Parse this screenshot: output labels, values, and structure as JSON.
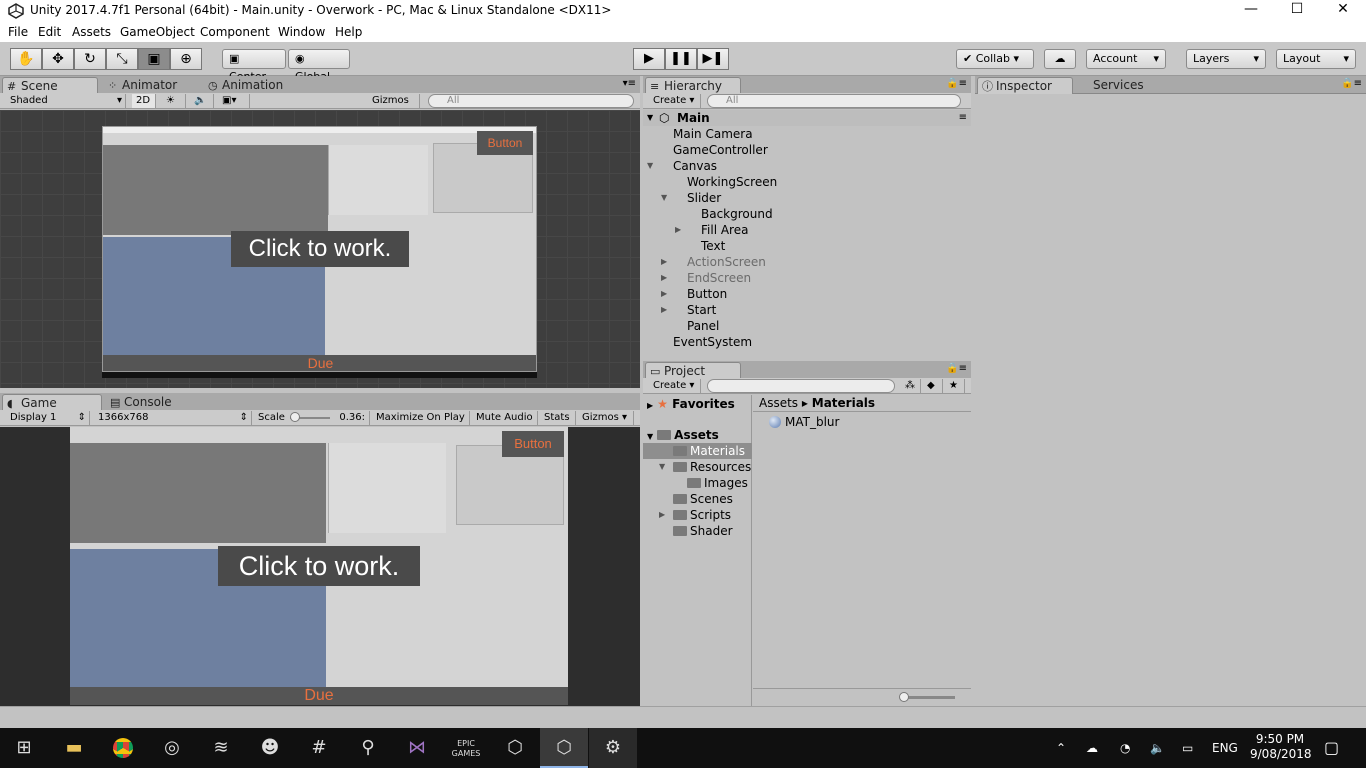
{
  "window": {
    "title": "Unity 2017.4.7f1 Personal (64bit) - Main.unity - Overwork - PC, Mac & Linux Standalone <DX11>",
    "minimize": "—",
    "maximize": "☐",
    "close": "✕"
  },
  "menu": [
    "File",
    "Edit",
    "Assets",
    "GameObject",
    "Component",
    "Window",
    "Help"
  ],
  "toolbar": {
    "tools": [
      "hand-tool",
      "move-tool",
      "rotate-tool",
      "scale-tool",
      "rect-tool",
      "transform-tool"
    ],
    "pivot": "Center",
    "space": "Global",
    "collab": "Collab",
    "account": "Account",
    "layers": "Layers",
    "layout": "Layout"
  },
  "scene": {
    "tabs": [
      "Scene",
      "Animator",
      "Animation"
    ],
    "shading": "Shaded",
    "mode_2d": "2D",
    "gizmos": "Gizmos",
    "search_placeholder": "All",
    "button_text": "Button",
    "click_text": "Click to work.",
    "due_text": "Due"
  },
  "game": {
    "tabs": [
      "Game",
      "Console"
    ],
    "display": "Display 1",
    "resolution": "1366x768",
    "scale_label": "Scale",
    "scale_value": "0.36:",
    "maximize_on_play": "Maximize On Play",
    "mute_audio": "Mute Audio",
    "stats": "Stats",
    "gizmos": "Gizmos",
    "button_text": "Button",
    "click_text": "Click to work.",
    "due_text": "Due"
  },
  "hierarchy": {
    "tab": "Hierarchy",
    "create": "Create",
    "search_placeholder": "All",
    "scene_name": "Main",
    "items": [
      {
        "label": "Main Camera",
        "depth": 1,
        "arrow": "",
        "dim": false
      },
      {
        "label": "GameController",
        "depth": 1,
        "arrow": "",
        "dim": false
      },
      {
        "label": "Canvas",
        "depth": 1,
        "arrow": "▼",
        "dim": false
      },
      {
        "label": "WorkingScreen",
        "depth": 2,
        "arrow": "",
        "dim": false
      },
      {
        "label": "Slider",
        "depth": 2,
        "arrow": "▼",
        "dim": false
      },
      {
        "label": "Background",
        "depth": 3,
        "arrow": "",
        "dim": false
      },
      {
        "label": "Fill Area",
        "depth": 3,
        "arrow": "▶",
        "dim": false
      },
      {
        "label": "Text",
        "depth": 3,
        "arrow": "",
        "dim": false
      },
      {
        "label": "ActionScreen",
        "depth": 2,
        "arrow": "▶",
        "dim": true
      },
      {
        "label": "EndScreen",
        "depth": 2,
        "arrow": "▶",
        "dim": true
      },
      {
        "label": "Button",
        "depth": 2,
        "arrow": "▶",
        "dim": false
      },
      {
        "label": "Start",
        "depth": 2,
        "arrow": "▶",
        "dim": false
      },
      {
        "label": "Panel",
        "depth": 2,
        "arrow": "",
        "dim": false
      },
      {
        "label": "EventSystem",
        "depth": 1,
        "arrow": "",
        "dim": false
      }
    ]
  },
  "project": {
    "tab": "Project",
    "create": "Create",
    "favorites": "Favorites",
    "assets": "Assets",
    "folders": [
      {
        "label": "Materials",
        "depth": 1,
        "arrow": "",
        "selected": true
      },
      {
        "label": "Resources",
        "depth": 1,
        "arrow": "▼",
        "selected": false
      },
      {
        "label": "Images",
        "depth": 2,
        "arrow": "",
        "selected": false
      },
      {
        "label": "Scenes",
        "depth": 1,
        "arrow": "",
        "selected": false
      },
      {
        "label": "Scripts",
        "depth": 1,
        "arrow": "▶",
        "selected": false
      },
      {
        "label": "Shader",
        "depth": 1,
        "arrow": "",
        "selected": false
      }
    ],
    "breadcrumb_root": "Assets",
    "breadcrumb_sep": "▸",
    "breadcrumb_current": "Materials",
    "files": [
      "MAT_blur"
    ]
  },
  "inspector": {
    "tabs": [
      "Inspector",
      "Services"
    ]
  },
  "taskbar": {
    "language": "ENG",
    "time": "9:50 PM",
    "date": "9/08/2018",
    "epic_label": "EPIC GAMES"
  }
}
